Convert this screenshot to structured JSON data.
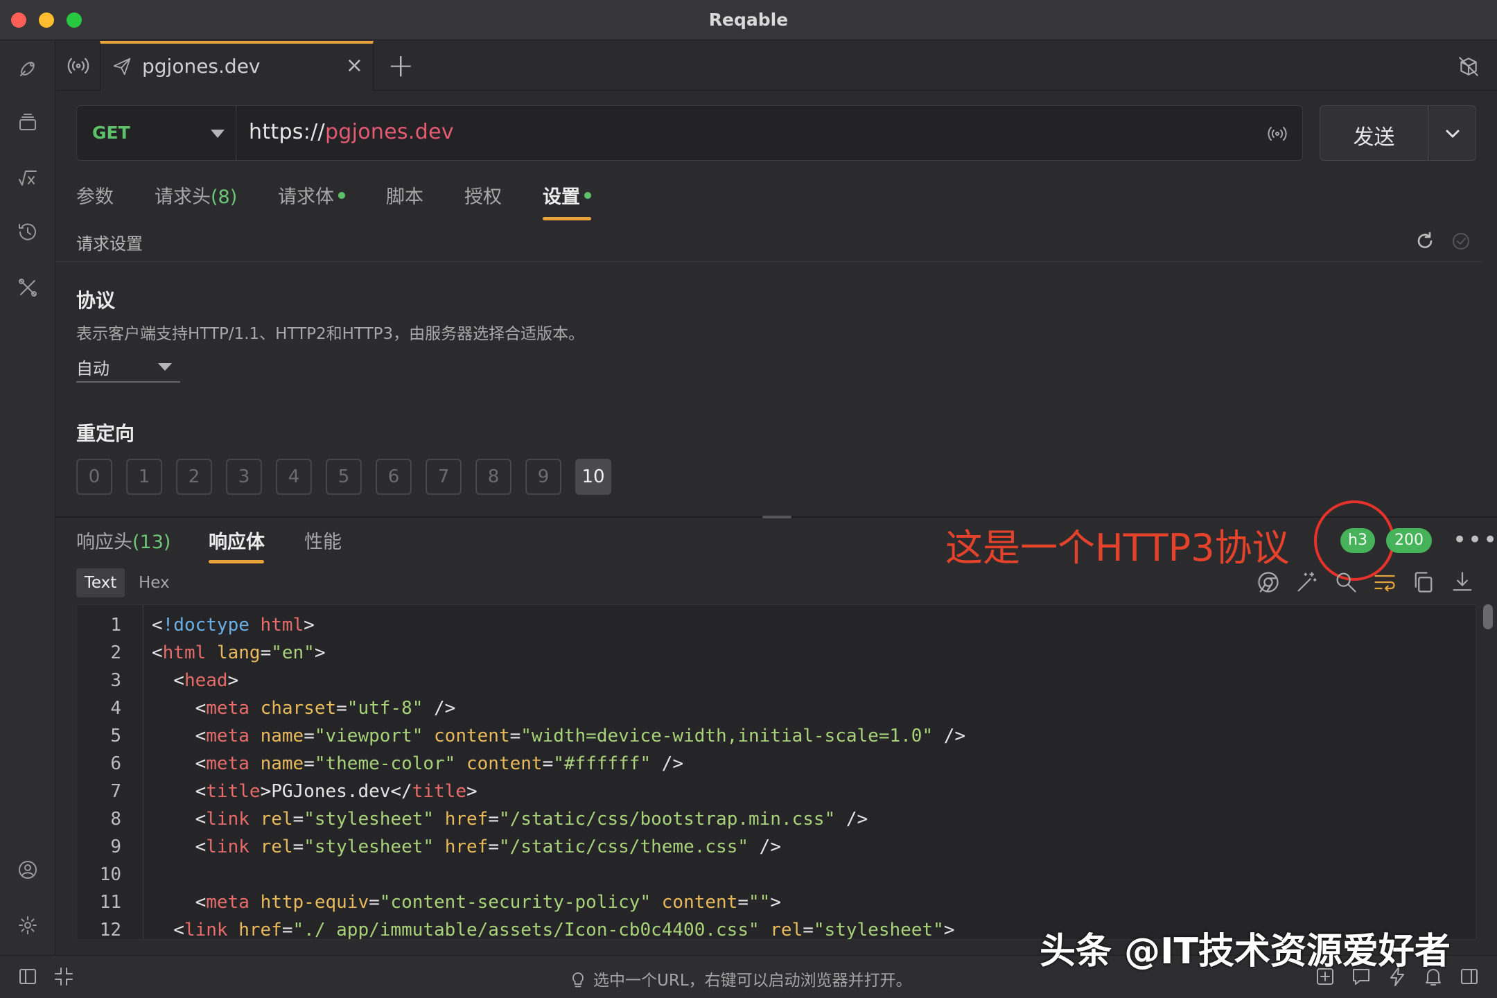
{
  "window": {
    "title": "Reqable"
  },
  "sidebar": {
    "icons": [
      "satellite-icon",
      "layers-icon",
      "function-icon",
      "history-icon",
      "tools-icon",
      "account-icon",
      "settings-icon"
    ]
  },
  "tabs": {
    "active": {
      "label": "pgjones.dev",
      "close": "×"
    },
    "add": "+"
  },
  "request": {
    "method": "GET",
    "url_scheme": "https://",
    "url_host": "pgjones.dev",
    "send_label": "发送"
  },
  "request_tabs": {
    "params": "参数",
    "headers": "请求头",
    "headers_count": "(8)",
    "body": "请求体",
    "script": "脚本",
    "auth": "授权",
    "settings": "设置"
  },
  "settings": {
    "section_title": "请求设置",
    "protocol_title": "协议",
    "protocol_desc": "表示客户端支持HTTP/1.1、HTTP2和HTTP3，由服务器选择合适版本。",
    "protocol_value": "自动",
    "redirect_title": "重定向",
    "redirect_options": [
      "0",
      "1",
      "2",
      "3",
      "4",
      "5",
      "6",
      "7",
      "8",
      "9",
      "10"
    ],
    "redirect_selected": "10"
  },
  "response": {
    "tabs": {
      "headers": "响应头",
      "headers_count": "(13)",
      "body": "响应体",
      "perf": "性能"
    },
    "annotation": "这是一个HTTP3协议",
    "protocol_badge": "h3",
    "status_badge": "200",
    "more": "•••",
    "format_text": "Text",
    "format_hex": "Hex",
    "line_numbers": [
      "1",
      "2",
      "3",
      "4",
      "5",
      "6",
      "7",
      "8",
      "9",
      "10",
      "11",
      "12"
    ]
  },
  "statusbar": {
    "hint": "选中一个URL，右键可以启动浏览器并打开。"
  },
  "watermark": "头条 @IT技术资源爱好者",
  "colors": {
    "accent": "#e8a33b",
    "method": "#5ec26b",
    "url_host": "#e65a73",
    "badge": "#46b25a",
    "annotation": "#e5422c"
  }
}
